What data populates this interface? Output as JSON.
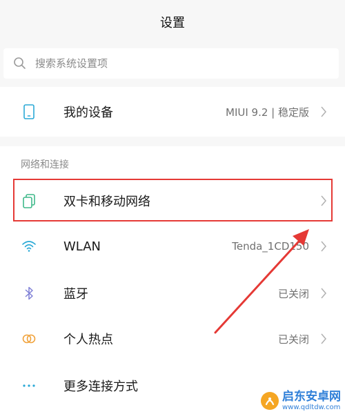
{
  "header": {
    "title": "设置"
  },
  "search": {
    "placeholder": "搜索系统设置项",
    "value": ""
  },
  "device_row": {
    "label": "我的设备",
    "value": "MIUI 9.2 | 稳定版",
    "icon": "phone-icon"
  },
  "network_section": {
    "header": "网络和连接",
    "items": [
      {
        "label": "双卡和移动网络",
        "value": "",
        "icon": "dual-sim-icon"
      },
      {
        "label": "WLAN",
        "value": "Tenda_1CD150",
        "icon": "wifi-icon"
      },
      {
        "label": "蓝牙",
        "value": "已关闭",
        "icon": "bluetooth-icon"
      },
      {
        "label": "个人热点",
        "value": "已关闭",
        "icon": "hotspot-icon"
      },
      {
        "label": "更多连接方式",
        "value": "",
        "icon": "more-dots-icon"
      }
    ]
  },
  "annotation": {
    "highlight_color": "#e53935"
  },
  "watermark": {
    "name": "启东安卓网",
    "url": "www.qdltdw.com"
  },
  "colors": {
    "accent": "#2aa9d6",
    "background": "#f7f7f7"
  }
}
